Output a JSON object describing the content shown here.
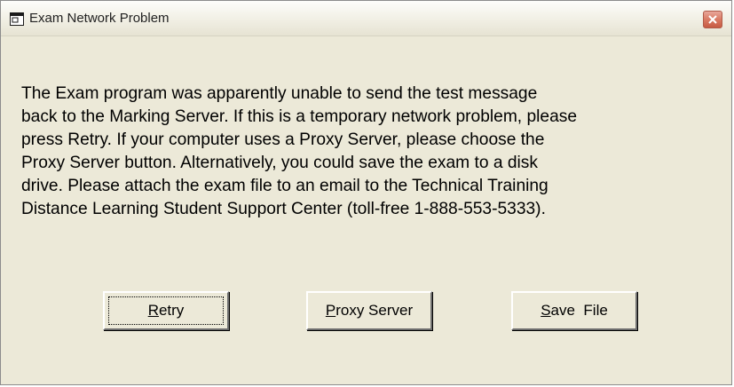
{
  "window": {
    "title": "Exam Network Problem",
    "icon": "app-window-icon",
    "close_icon": "close-icon"
  },
  "message": "The Exam program was apparently unable to send the test message\nback to the Marking Server. If this is a temporary network problem, please\npress Retry.  If your computer uses a Proxy Server, please choose the\nProxy Server button.  Alternatively, you could save the exam to a disk\ndrive.  Please attach the exam file to an email to the Technical Training\nDistance Learning Student Support Center (toll-free 1-888-553-5333).",
  "buttons": {
    "retry": {
      "mnemonic": "R",
      "rest": "etry"
    },
    "proxy": {
      "mnemonic": "P",
      "rest": "roxy Server"
    },
    "save": {
      "mnemonic": "S",
      "rest": "ave  File"
    }
  },
  "colors": {
    "dialog_bg": "#ece9d8",
    "close_button": "#d97a63"
  }
}
